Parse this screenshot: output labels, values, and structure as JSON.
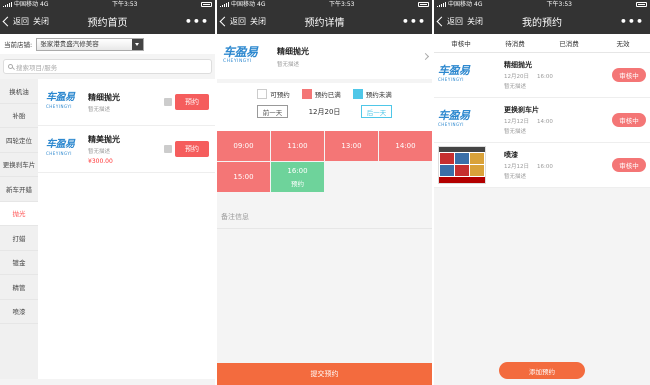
{
  "status": {
    "carrier": "中国移动",
    "network": "4G",
    "time": "下午3:53"
  },
  "nav": {
    "back_label": "返回",
    "close_label": "关闭",
    "more_label": "•••"
  },
  "screen1": {
    "title": "预约首页",
    "store_label": "当前店铺:",
    "store_value": "张家港贵盛汽修美容",
    "search_placeholder": "搜索项目/服务",
    "categories": [
      "换机油",
      "补胎",
      "四轮定位",
      "更换刹车片",
      "新车开蜡",
      "抛光",
      "打蜡",
      "镀金",
      "精管",
      "喷漆"
    ],
    "active_category_index": 5,
    "products": [
      {
        "name": "精细抛光",
        "desc": "暂无描述",
        "price": "",
        "book_label": "预约"
      },
      {
        "name": "精美抛光",
        "desc": "暂无描述",
        "price": "¥300.00",
        "book_label": "预约"
      }
    ]
  },
  "screen2": {
    "title": "预约详情",
    "product_name": "精细抛光",
    "product_desc": "暂无描述",
    "legend": {
      "free": "可预约",
      "full": "预约已满",
      "unfull": "预约未满"
    },
    "prev_day": "前一天",
    "date": "12月20日",
    "next_day": "后一天",
    "slots": [
      {
        "time": "09:00",
        "state": ""
      },
      {
        "time": "11:00",
        "state": ""
      },
      {
        "time": "13:00",
        "state": ""
      },
      {
        "time": "14:00",
        "state": ""
      },
      {
        "time": "15:00",
        "state": ""
      },
      {
        "time": "16:00",
        "state": "预约"
      }
    ],
    "remark_label": "备注信息",
    "submit_label": "提交预约"
  },
  "screen3": {
    "title": "我的预约",
    "tabs": [
      "审核中",
      "待消费",
      "已消费",
      "无效"
    ],
    "orders": [
      {
        "name": "精细抛光",
        "date": "12月20日",
        "time": "16:00",
        "desc": "暂无描述",
        "status": "审核中"
      },
      {
        "name": "更换刹车片",
        "date": "12月12日",
        "time": "14:00",
        "desc": "暂无描述",
        "status": "审核中"
      },
      {
        "name": "喷漆",
        "date": "12月12日",
        "time": "16:00",
        "desc": "暂无描述",
        "status": "审核中"
      }
    ],
    "add_label": "添加预约"
  },
  "logo": {
    "zh": "车盈易",
    "en": "CHEYINGYI"
  },
  "colors": {
    "accent": "#f55d5d",
    "full": "#f47676",
    "available": "#6ed39b",
    "unfull": "#4fc7e8",
    "submit": "#f36b3e"
  }
}
